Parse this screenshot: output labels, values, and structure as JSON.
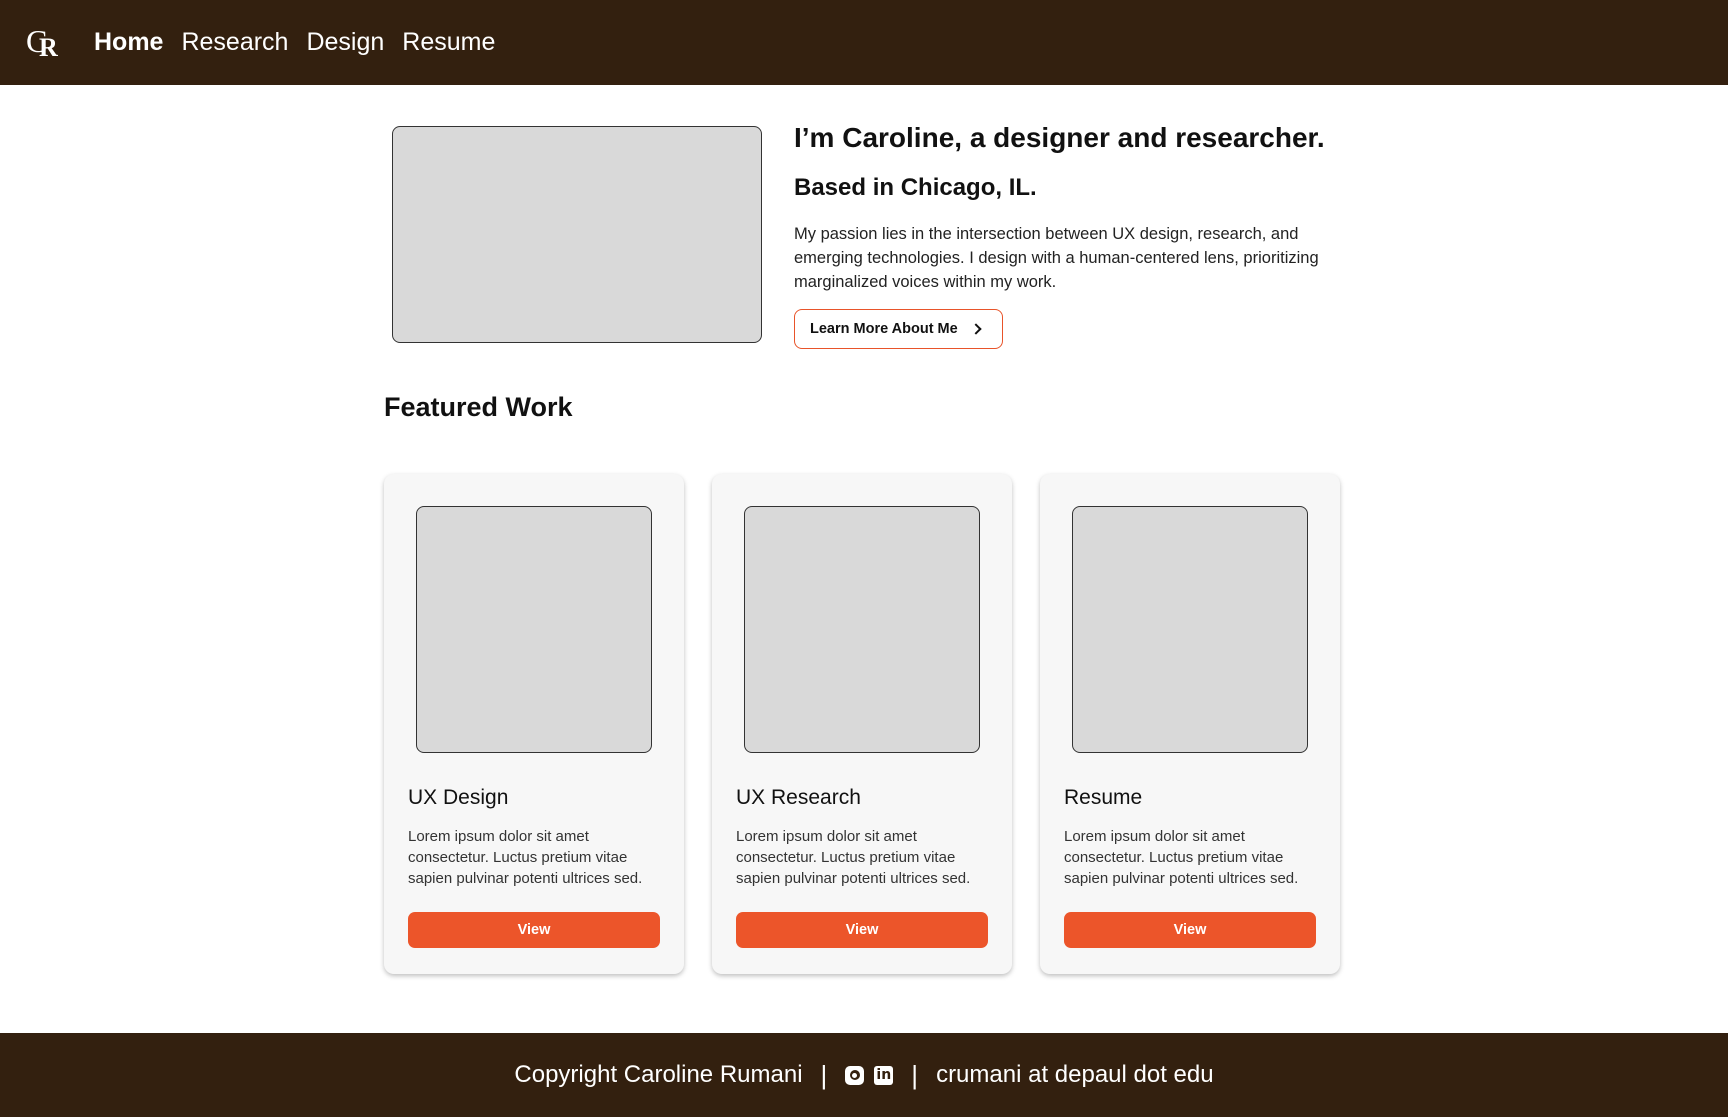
{
  "nav": {
    "logo": {
      "c": "C",
      "r": "R"
    },
    "links": [
      "Home",
      "Research",
      "Design",
      "Resume"
    ]
  },
  "hero": {
    "title": "I’m Caroline, a designer and researcher.",
    "subtitle": "Based in Chicago, IL.",
    "description": "My passion lies in the intersection between UX design, research, and emerging technologies. I design with a human-centered lens, prioritizing marginalized voices within my work.",
    "button": "Learn More About Me"
  },
  "featured": {
    "title": "Featured Work",
    "cards": [
      {
        "title": "UX Design",
        "description": "Lorem ipsum dolor sit amet consectetur. Luctus pretium vitae sapien pulvinar potenti ultrices sed.",
        "button": "View"
      },
      {
        "title": "UX Research",
        "description": "Lorem ipsum dolor sit amet consectetur. Luctus pretium vitae sapien pulvinar potenti ultrices sed.",
        "button": "View"
      },
      {
        "title": "Resume",
        "description": "Lorem ipsum dolor sit amet consectetur. Luctus pretium vitae sapien pulvinar potenti ultrices sed.",
        "button": "View"
      }
    ]
  },
  "footer": {
    "copyright": "Copyright Caroline Rumani",
    "separator": "|",
    "email": "crumani at depaul dot edu",
    "icons": [
      "instagram-icon",
      "linkedin-icon"
    ],
    "linkedin_glyph": "in"
  },
  "colors": {
    "header_bg": "#33200f",
    "accent": "#ec552a",
    "placeholder": "#d9d9d9"
  }
}
